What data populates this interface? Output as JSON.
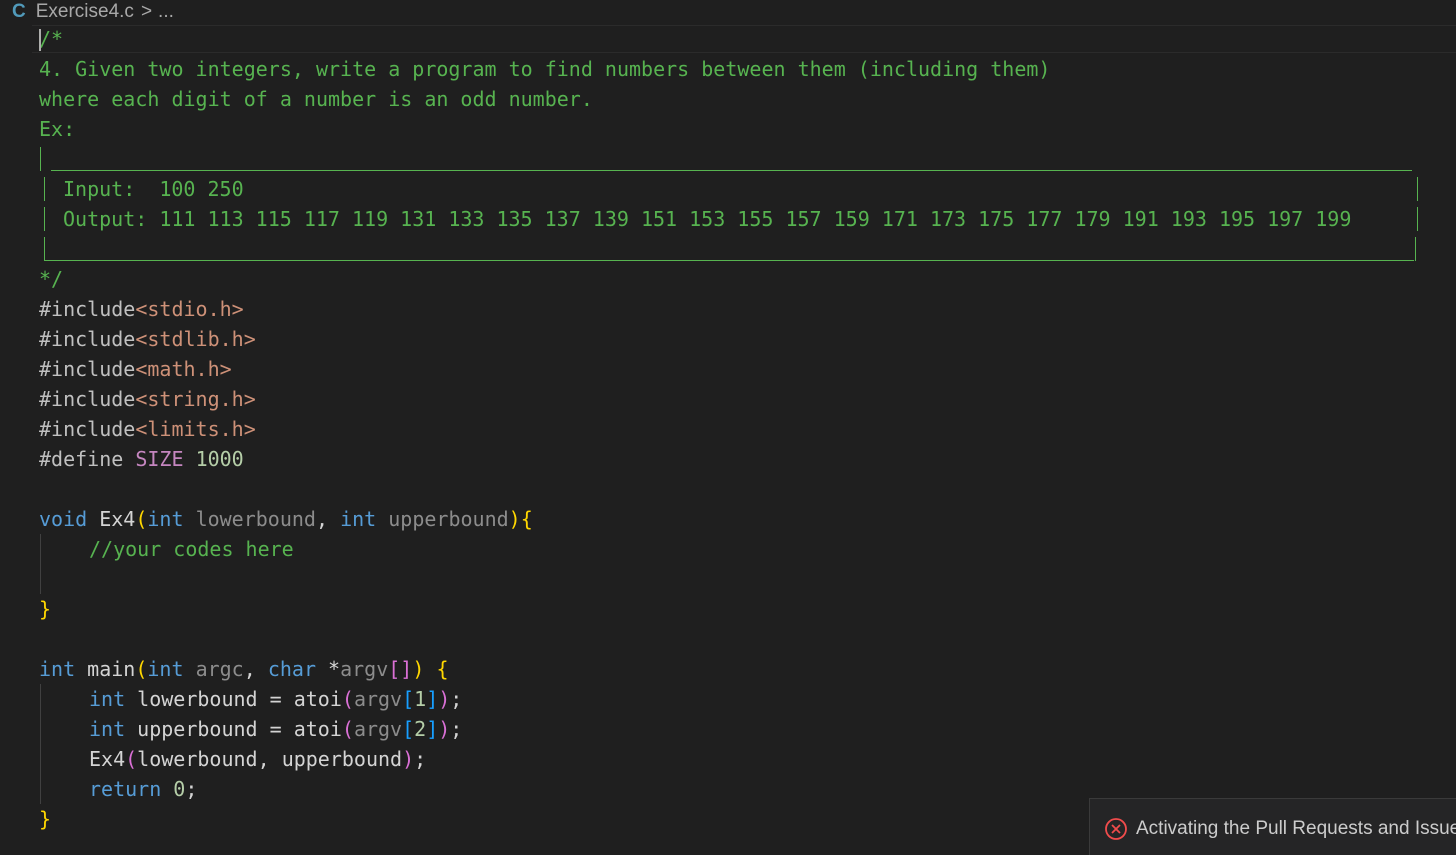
{
  "breadcrumb": {
    "lang_icon": "C",
    "file": "Exercise4.c",
    "separator": ">",
    "rest": "..."
  },
  "code": {
    "l1": "/*",
    "l2": "4. Given two integers, write a program to find numbers between them (including them)",
    "l3": "where each digit of a number is an odd number.",
    "l4": "Ex:",
    "l6a": "Input:  100 250",
    "l7a": "Output: 111 113 115 117 119 131 133 135 137 139 151 153 155 157 159 171 173 175 177 179 191 193 195 197 199",
    "l9": "*/",
    "inc1": "<stdio.h>",
    "inc2": "<stdlib.h>",
    "inc3": "<math.h>",
    "inc4": "<string.h>",
    "inc5": "<limits.h>",
    "include_kw": "#include",
    "define_kw": "#define",
    "define_name": "SIZE",
    "define_val": "1000",
    "void": "void",
    "ex4": "Ex4",
    "int": "int",
    "lowerbound": "lowerbound",
    "upperbound": "upperbound",
    "comment_body": "//your codes here",
    "main": "main",
    "argc": "argc",
    "char": "char",
    "argv": "argv",
    "atoi": "atoi",
    "idx1": "1",
    "idx2": "2",
    "return": "return",
    "zero": "0"
  },
  "notification": {
    "icon": "error-circle-icon",
    "text": "Activating the Pull Requests and Issues"
  },
  "colors": {
    "comment": "#57b350",
    "keyword": "#569cd6",
    "string": "#ce9178",
    "macro": "#c586c0",
    "number": "#b5cea8",
    "bracket_gold": "#ffd700",
    "bracket_pink": "#da70d6",
    "bracket_blue": "#179fff"
  }
}
